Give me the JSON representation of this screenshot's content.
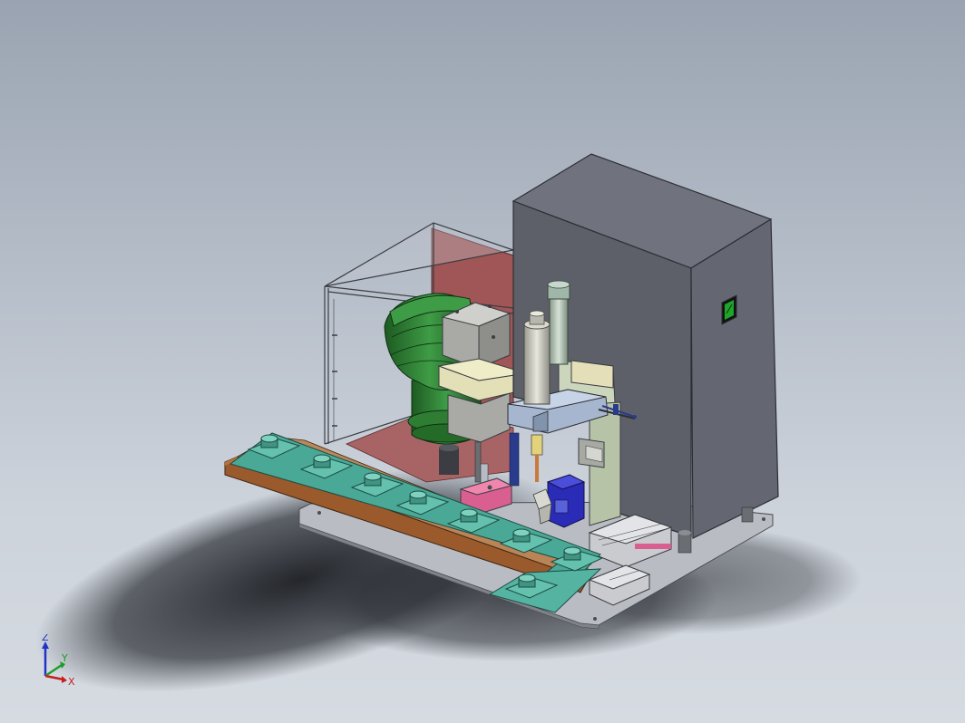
{
  "viewport": {
    "background_top": "#9aa3b1",
    "background_bottom": "#d6dbe2"
  },
  "model": {
    "cabinet_color": "#5a5e6a",
    "panel_color": "#a7b6cf",
    "feeder_color": "#2e7d32",
    "track_color": "#4aa896",
    "rail_color": "#9a5a2c",
    "back_panel_color": "#a05656",
    "switch_color": "#1fa52a"
  },
  "triad": {
    "z_label": "Z",
    "y_label": "Y",
    "x_label": "X",
    "z_color": "#1e34c8",
    "y_color": "#1a9e2a",
    "x_color": "#c81e1e"
  }
}
